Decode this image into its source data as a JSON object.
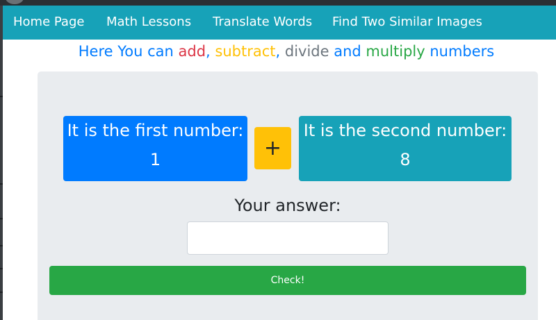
{
  "nav": {
    "items": [
      {
        "label": "Home Page"
      },
      {
        "label": "Math Lessons"
      },
      {
        "label": "Translate Words"
      },
      {
        "label": "Find Two Similar Images"
      }
    ]
  },
  "headline": {
    "part1": "Here You can ",
    "add": "add",
    "sep1": ", ",
    "subtract": "subtract",
    "sep2": ", ",
    "divide": "divide",
    "and": " and ",
    "multiply": "multiply",
    "tail": " numbers"
  },
  "problem": {
    "first_label": "It is the first number:",
    "first_value": "1",
    "operator": "+",
    "second_label": "It is the second number:",
    "second_value": "8"
  },
  "answer": {
    "label": "Your answer:",
    "value": "",
    "placeholder": ""
  },
  "check_button": {
    "label": "Check!"
  },
  "colors": {
    "navbar": "#17a2b8",
    "primary": "#007bff",
    "danger": "#dc3545",
    "warning": "#ffc107",
    "secondary": "#6c757d",
    "success": "#28a745",
    "info": "#17a2b8",
    "panel": "#e9ecef"
  }
}
